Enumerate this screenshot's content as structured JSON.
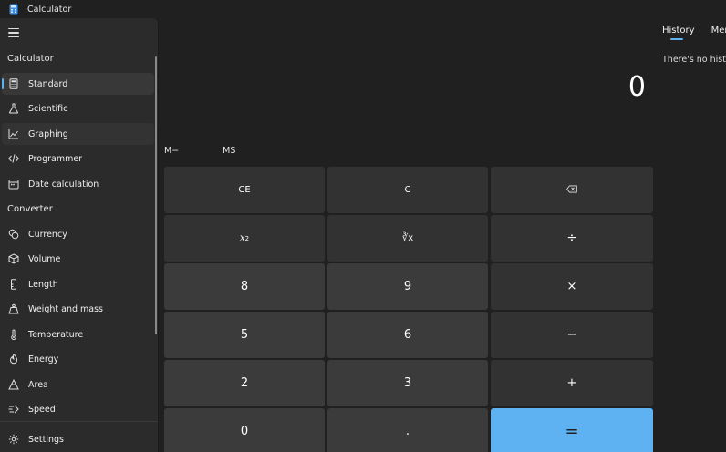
{
  "window": {
    "title": "Calculator"
  },
  "display": {
    "value": "0"
  },
  "memory": {
    "minus_label": "M−",
    "store_label": "MS"
  },
  "keys": {
    "ce": "CE",
    "c": "C",
    "backspace": "⌫",
    "square": "x",
    "square_exp": "2",
    "cuberoot": "∛x",
    "divide": "÷",
    "eight": "8",
    "nine": "9",
    "multiply": "×",
    "five": "5",
    "six": "6",
    "minus": "−",
    "two": "2",
    "three": "3",
    "plus": "+",
    "zero": "0",
    "decimal": ".",
    "equals": "="
  },
  "history": {
    "tabs": [
      {
        "label": "History"
      },
      {
        "label": "Memory"
      }
    ],
    "empty_text": "There's no history yet"
  },
  "nav": {
    "calculator_section": "Calculator",
    "converter_section": "Converter",
    "items": [
      {
        "label": "Standard",
        "icon": "calculator-icon"
      },
      {
        "label": "Scientific",
        "icon": "flask-icon"
      },
      {
        "label": "Graphing",
        "icon": "graph-icon"
      },
      {
        "label": "Programmer",
        "icon": "code-icon"
      },
      {
        "label": "Date calculation",
        "icon": "calendar-icon"
      },
      {
        "label": "Currency",
        "icon": "currency-icon"
      },
      {
        "label": "Volume",
        "icon": "cube-icon"
      },
      {
        "label": "Length",
        "icon": "ruler-icon"
      },
      {
        "label": "Weight and mass",
        "icon": "weight-icon"
      },
      {
        "label": "Temperature",
        "icon": "thermometer-icon"
      },
      {
        "label": "Energy",
        "icon": "flame-icon"
      },
      {
        "label": "Area",
        "icon": "area-icon"
      },
      {
        "label": "Speed",
        "icon": "speed-icon"
      }
    ],
    "settings_label": "Settings"
  },
  "colors": {
    "accent": "#5fb2f2",
    "background": "#202020",
    "drawer": "#2b2b2b",
    "key": "#3a3a3a"
  }
}
